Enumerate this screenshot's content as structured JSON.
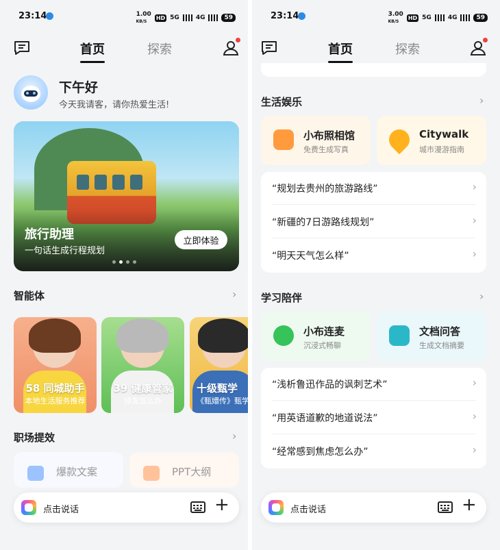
{
  "left": {
    "status": {
      "time": "23:14",
      "speed": "1.00",
      "speed_unit": "KB/S",
      "hd": "HD",
      "net1": "5G",
      "net2": "4G",
      "battery": "59"
    },
    "tabs": [
      "首页",
      "探索"
    ],
    "greeting": {
      "title": "下午好",
      "subtitle": "今天我请客，请你热爱生活!"
    },
    "banner": {
      "title": "旅行助理",
      "subtitle": "一句话生成行程规划",
      "button": "立即体验",
      "dots": 4,
      "active_dot": 2
    },
    "section_agents": {
      "title": "智能体",
      "chevron": "›"
    },
    "agents": [
      {
        "name": "58 同城助手",
        "desc": "本地生活服务推荐",
        "color": "#f08f67"
      },
      {
        "name": "39 健康管家",
        "desc": "掉发怎么办",
        "color": "#5fbf56"
      },
      {
        "name": "十级甄学",
        "desc": "《甄嬛传》甄学",
        "color": "#f0b83f"
      }
    ],
    "section_work": {
      "title": "职场提效",
      "chevron": "›"
    },
    "work": [
      {
        "label": "爆款文案",
        "icon_color": "#9cc3ff"
      },
      {
        "label": "PPT大纲",
        "icon_color": "#ffc29a"
      }
    ],
    "input": {
      "placeholder": "点击说话",
      "keyboard_icon": "keyboard-icon",
      "plus": "+"
    }
  },
  "right": {
    "status": {
      "time": "23:14",
      "speed": "3.00",
      "speed_unit": "KB/S",
      "hd": "HD",
      "net1": "5G",
      "net2": "4G",
      "battery": "59"
    },
    "tabs": [
      "首页",
      "探索"
    ],
    "section_life": {
      "title": "生活娱乐",
      "chevron": "›"
    },
    "life_cards": [
      {
        "title": "小布照相馆",
        "subtitle": "免费生成写真",
        "bg": "#fff6ea",
        "icon": "#ff9b3d"
      },
      {
        "title": "Citywalk",
        "subtitle": "城市漫游指南",
        "bg": "#fff8e8",
        "icon": "#ffb21e"
      }
    ],
    "life_queries": [
      "“规划去贵州的旅游路线”",
      "“新疆的7日游路线规划”",
      "“明天天气怎么样”"
    ],
    "section_study": {
      "title": "学习陪伴",
      "chevron": "›"
    },
    "study_cards": [
      {
        "title": "小布连麦",
        "subtitle": "沉浸式畅聊",
        "bg": "#eefaf0",
        "icon": "#35c35a"
      },
      {
        "title": "文档问答",
        "subtitle": "生成文档摘要",
        "bg": "#eaf8fb",
        "icon": "#2ab8c9"
      }
    ],
    "study_queries": [
      "“浅析鲁迅作品的讽刺艺术”",
      "“用英语道歉的地道说法”",
      "“经常感到焦虑怎么办”"
    ],
    "input": {
      "placeholder": "点击说话",
      "keyboard_icon": "keyboard-icon",
      "plus": "+"
    }
  }
}
